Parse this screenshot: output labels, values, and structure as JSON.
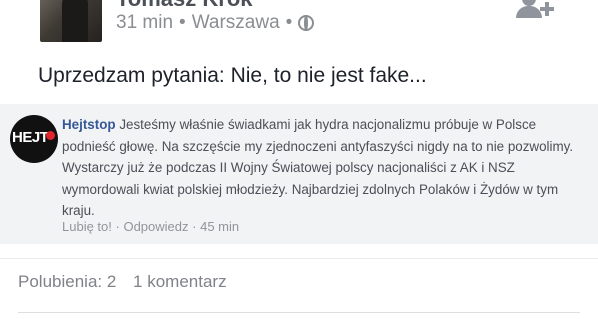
{
  "post": {
    "author": "Tomasz Krok",
    "time": "31 min",
    "location": "Warszawa",
    "separator": "•",
    "text": "Uprzedzam pytania: Nie, to nie jest fake..."
  },
  "comment": {
    "avatar_text": "HEJT",
    "author": "Hejtstop",
    "text": "Jesteśmy właśnie świadkami jak hydra nacjonalizmu próbuje w Polsce podnieść głowę. Na szczęście my zjednoczeni antyfaszyści nigdy na to nie pozwolimy. Wystarczy już że podczas II Wojny Światowej polscy nacjonaliści z AK i NSZ wymordowali kwiat polskiej młodzieży. Najbardziej zdolnych Polaków i Żydów w tym kraju.",
    "like_label": "Lubię to!",
    "reply_label": "Odpowiedz",
    "dot": "·",
    "time": "45 min"
  },
  "stats": {
    "likes": "Polubienia: 2",
    "comments": "1 komentarz"
  },
  "colors": {
    "link": "#365899",
    "muted": "#90949c",
    "comment_bg": "#f2f3f5"
  },
  "icons": {
    "audience": "globe-icon",
    "add_friend": "add-friend-icon"
  }
}
